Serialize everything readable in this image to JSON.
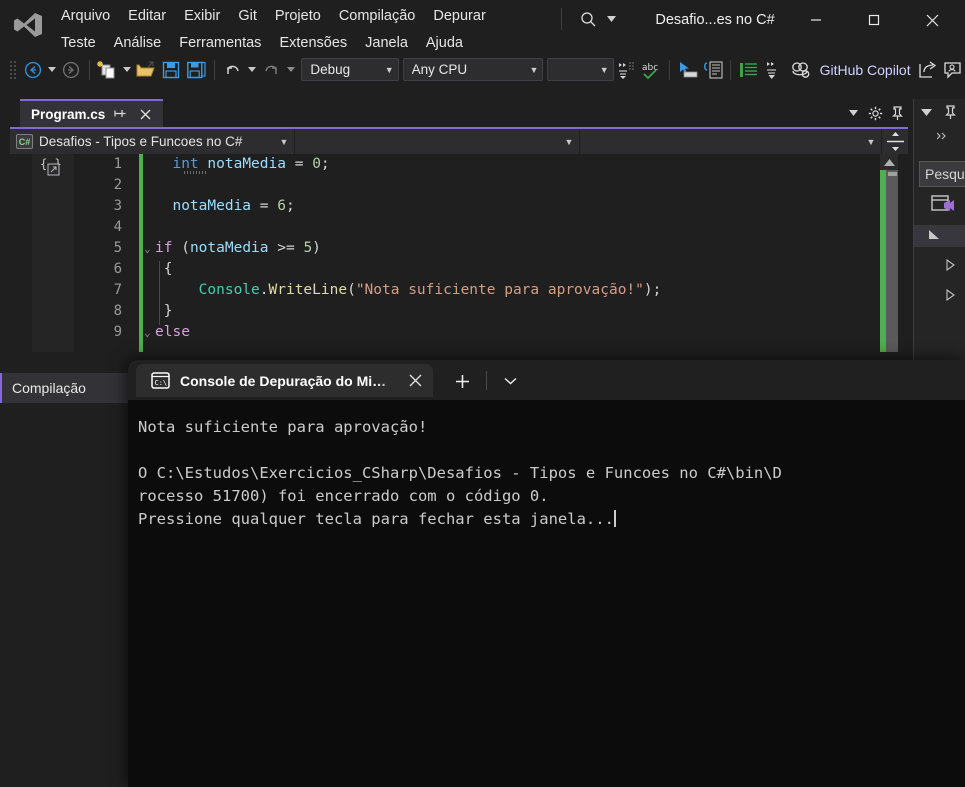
{
  "app": {
    "logo_icon": "visual-studio-logo",
    "window_title": "Desafio...es no C#",
    "search_icon": "search-icon",
    "search_caret_icon": "chevron-down-icon",
    "minimize_icon": "minimize-icon",
    "maximize_icon": "maximize-icon",
    "close_icon": "close-icon"
  },
  "menubar": {
    "row1": [
      "Arquivo",
      "Editar",
      "Exibir",
      "Git",
      "Projeto",
      "Compilação",
      "Depurar"
    ],
    "row2": [
      "Teste",
      "Análise",
      "Ferramentas",
      "Extensões",
      "Janela",
      "Ajuda"
    ]
  },
  "toolbar": {
    "grip_icon": "drag-grip-icon",
    "nav_back_icon": "navigate-back-icon",
    "nav_back_caret_icon": "chevron-down-icon",
    "nav_forward_icon": "navigate-forward-icon",
    "new_project_icon": "new-project-icon",
    "new_project_caret_icon": "chevron-down-icon",
    "open_file_icon": "open-file-icon",
    "save_icon": "save-icon",
    "save_all_icon": "save-all-icon",
    "undo_icon": "undo-icon",
    "undo_caret_icon": "chevron-down-icon",
    "redo_icon": "redo-icon",
    "redo_caret_icon": "chevron-down-icon",
    "config_value": "Debug",
    "platform_value": "Any CPU",
    "start_value": "",
    "start_caret_icon": "chevron-down-icon",
    "stepping_icon": "stepping-icon",
    "spellcheck_icon": "spellcheck-abc-icon",
    "pointer_select_icon": "pointer-select-icon",
    "comment_icon": "comment-block-icon",
    "indent_icon": "indent-icon",
    "outdent_icon": "line-spacing-icon",
    "copilot_icon": "github-copilot-icon",
    "copilot_label": "GitHub Copilot",
    "share_icon": "share-icon",
    "feedback_icon": "feedback-icon"
  },
  "editor": {
    "tab": {
      "title": "Program.cs",
      "pin_icon": "pin-icon",
      "close_icon": "close-icon",
      "overflow_caret_icon": "chevron-down-icon",
      "settings_icon": "gear-icon",
      "pin_dock_icon": "pin-dock-icon"
    },
    "navbar": {
      "project_icon": "csharp-project-icon",
      "project_name": "Desafios - Tipos e Funcoes no C#",
      "project_caret_icon": "chevron-down-icon",
      "member_value": "",
      "member_caret_icon": "chevron-down-icon",
      "split_view_icon": "split-view-icon"
    },
    "brace_icon": "brace-match-icon",
    "scrollbar": {
      "up_arrow_icon": "scroll-up-icon",
      "change_color": "#4caf50",
      "thumb_color": "#5a5a5a"
    },
    "line_numbers": [
      "1",
      "2",
      "3",
      "4",
      "5",
      "6",
      "7",
      "8",
      "9"
    ],
    "lines": [
      {
        "n": "1",
        "fold": "",
        "tokens": [
          {
            "t": "  ",
            "c": "pun"
          },
          {
            "t": "int",
            "c": "typ"
          },
          {
            "t": " ",
            "c": "pun"
          },
          {
            "t": "notaMedia",
            "c": "var"
          },
          {
            "t": " ",
            "c": "pun"
          },
          {
            "t": "=",
            "c": "pun"
          },
          {
            "t": " ",
            "c": "pun"
          },
          {
            "t": "0",
            "c": "num"
          },
          {
            "t": ";",
            "c": "pun"
          }
        ]
      },
      {
        "n": "2",
        "fold": "",
        "tokens": []
      },
      {
        "n": "3",
        "fold": "",
        "tokens": [
          {
            "t": "  ",
            "c": "pun"
          },
          {
            "t": "notaMedia",
            "c": "var"
          },
          {
            "t": " ",
            "c": "pun"
          },
          {
            "t": "=",
            "c": "pun"
          },
          {
            "t": " ",
            "c": "pun"
          },
          {
            "t": "6",
            "c": "num"
          },
          {
            "t": ";",
            "c": "pun"
          }
        ]
      },
      {
        "n": "4",
        "fold": "",
        "tokens": []
      },
      {
        "n": "5",
        "fold": "v",
        "tokens": [
          {
            "t": "if",
            "c": "kw"
          },
          {
            "t": " (",
            "c": "pun"
          },
          {
            "t": "notaMedia",
            "c": "var"
          },
          {
            "t": " >= ",
            "c": "pun"
          },
          {
            "t": "5",
            "c": "num"
          },
          {
            "t": ")",
            "c": "pun"
          }
        ]
      },
      {
        "n": "6",
        "fold": "",
        "tokens": [
          {
            "t": " {",
            "c": "pun"
          }
        ]
      },
      {
        "n": "7",
        "fold": "",
        "tokens": [
          {
            "t": "     ",
            "c": "pun"
          },
          {
            "t": "Console",
            "c": "cls"
          },
          {
            "t": ".",
            "c": "pun"
          },
          {
            "t": "WriteLine",
            "c": "mth"
          },
          {
            "t": "(",
            "c": "pun"
          },
          {
            "t": "\"Nota suficiente para aprovação!\"",
            "c": "str"
          },
          {
            "t": ");",
            "c": "pun"
          }
        ]
      },
      {
        "n": "8",
        "fold": "",
        "tokens": [
          {
            "t": " }",
            "c": "pun"
          }
        ]
      },
      {
        "n": "9",
        "fold": "v",
        "tokens": [
          {
            "t": "else",
            "c": "kw"
          }
        ]
      }
    ]
  },
  "right_panel": {
    "chevron_icon": "chevron-down-icon",
    "pin_icon": "pin-icon",
    "collapse_icon": "collapse-right-icon",
    "search_placeholder": "Pesqu",
    "solution_icon": "solution-explorer-icon",
    "expanded_icon": "triangle-expanded-icon",
    "collapsed_icon_1": "triangle-collapsed-icon",
    "collapsed_icon_2": "triangle-collapsed-icon"
  },
  "bottom_dock": {
    "tab_label": "Compilação"
  },
  "console": {
    "tab_icon": "console-cmd-icon",
    "tab_label": "Console de Depuração do Mi…",
    "tab_label_full": "Console de Depuração do Microsoft Visual Studio",
    "close_icon": "close-icon",
    "new_tab_icon": "plus-icon",
    "dropdown_icon": "chevron-down-icon",
    "output_lines": [
      "Nota suficiente para aprovação!",
      "",
      "O C:\\Estudos\\Exercicios_CSharp\\Desafios - Tipos e Funcoes no C#\\bin\\D",
      "rocesso 51700) foi encerrado com o código 0.",
      "Pressione qualquer tecla para fechar esta janela..."
    ]
  },
  "colors": {
    "accent_purple": "#8169d8",
    "change_green": "#4caf50",
    "copilot_text": "#cfd3ff",
    "console_bg": "#0c0c0c",
    "chrome_bg": "#1f1f1f"
  }
}
